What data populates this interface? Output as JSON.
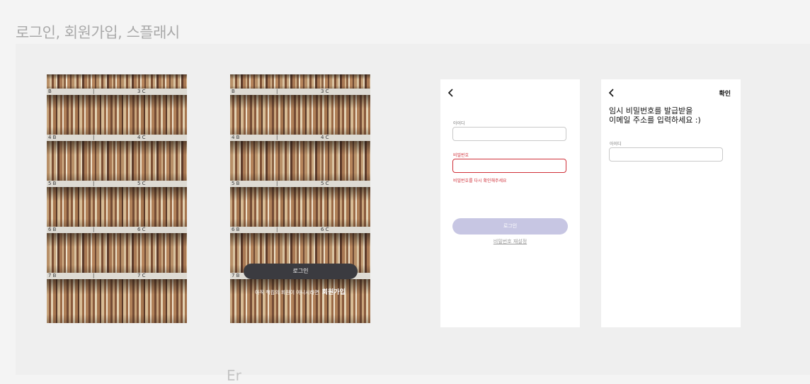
{
  "page_title": "로그인, 회원가입, 스플래시",
  "bottom_label": "Er",
  "shelf_labels": {
    "row1": [
      "B",
      "|",
      "3 C"
    ],
    "row2": [
      "4 B",
      "|",
      "4 C"
    ],
    "row3": [
      "5 B",
      "|",
      "5 C"
    ],
    "row4": [
      "6 B",
      "|",
      "6 C"
    ],
    "row5": [
      "7 B",
      "|",
      "7 C"
    ]
  },
  "landing": {
    "login_button": "로그인",
    "signup_prompt": "아직 책킴의 회원이 아니시라면",
    "signup_link": "회원가입"
  },
  "login": {
    "id_label": "아이디",
    "id_value": "",
    "password_label": "비밀번호",
    "password_value": "",
    "password_error": "비밀번호를 다시 확인해주세요",
    "login_button": "로그인",
    "reset_password_link": "비밀번호 재설정"
  },
  "reset": {
    "confirm_button": "확인",
    "heading_line1": "임시 비밀번호를 발급받을",
    "heading_line2": "이메일 주소를 입력하세요 :)",
    "id_label": "아이디",
    "id_value": ""
  },
  "colors": {
    "error": "#d0313a",
    "button_disabled": "#c7c6e3",
    "dark_button": "#3b3b40"
  }
}
